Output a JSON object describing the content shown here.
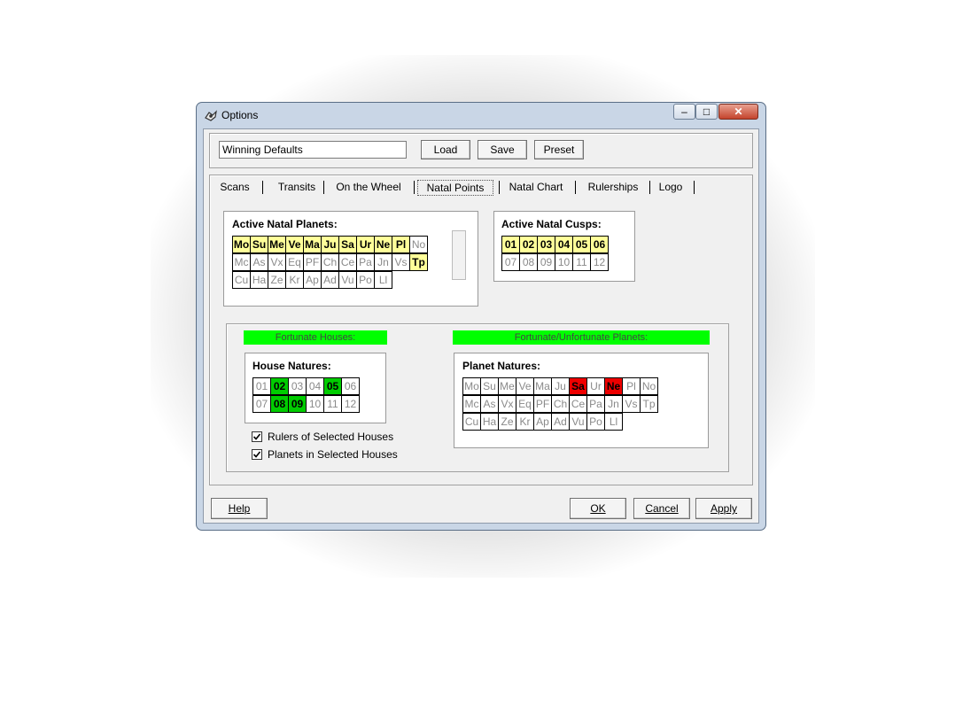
{
  "window": {
    "title": "Options"
  },
  "profile": {
    "name_value": "Winning Defaults",
    "load_label": "Load",
    "save_label": "Save",
    "preset_label": "Preset"
  },
  "tabs": [
    {
      "label": "Scans"
    },
    {
      "label": "Transits"
    },
    {
      "label": "On the Wheel"
    },
    {
      "label": "Natal Points"
    },
    {
      "label": "Natal Chart"
    },
    {
      "label": "Rulerships"
    },
    {
      "label": "Logo"
    }
  ],
  "active_tab": "Natal Points",
  "natal_planets": {
    "title": "Active Natal Planets:",
    "rows": [
      [
        "Mo",
        "Su",
        "Me",
        "Ve",
        "Ma",
        "Ju",
        "Sa",
        "Ur",
        "Ne",
        "Pl",
        "No"
      ],
      [
        "Mc",
        "As",
        "Vx",
        "Eq",
        "PF",
        "Ch",
        "Ce",
        "Pa",
        "Jn",
        "Vs",
        "Tp"
      ],
      [
        "Cu",
        "Ha",
        "Ze",
        "Kr",
        "Ap",
        "Ad",
        "Vu",
        "Po",
        "Ll"
      ]
    ],
    "active": [
      "Mo",
      "Su",
      "Me",
      "Ve",
      "Ma",
      "Ju",
      "Sa",
      "Ur",
      "Ne",
      "Pl",
      "Tp"
    ]
  },
  "natal_cusps": {
    "title": "Active Natal Cusps:",
    "rows": [
      [
        "01",
        "02",
        "03",
        "04",
        "05",
        "06"
      ],
      [
        "07",
        "08",
        "09",
        "10",
        "11",
        "12"
      ]
    ],
    "active": [
      "01",
      "02",
      "03",
      "04",
      "05",
      "06"
    ]
  },
  "fortunate_houses": {
    "bar_label": "Fortunate Houses:",
    "title": "House Natures:",
    "rows": [
      [
        "01",
        "02",
        "03",
        "04",
        "05",
        "06"
      ],
      [
        "07",
        "08",
        "09",
        "10",
        "11",
        "12"
      ]
    ],
    "fortunate": [
      "02",
      "05",
      "08",
      "09"
    ]
  },
  "fortunate_planets": {
    "bar_label": "Fortunate/Unfortunate Planets:",
    "title": "Planet Natures:",
    "rows": [
      [
        "Mo",
        "Su",
        "Me",
        "Ve",
        "Ma",
        "Ju",
        "Sa",
        "Ur",
        "Ne",
        "Pl",
        "No"
      ],
      [
        "Mc",
        "As",
        "Vx",
        "Eq",
        "PF",
        "Ch",
        "Ce",
        "Pa",
        "Jn",
        "Vs",
        "Tp"
      ],
      [
        "Cu",
        "Ha",
        "Ze",
        "Kr",
        "Ap",
        "Ad",
        "Vu",
        "Po",
        "Ll"
      ]
    ],
    "unfortunate": [
      "Sa",
      "Ne"
    ]
  },
  "options": {
    "rulers_label": "Rulers of Selected Houses",
    "rulers_checked": true,
    "planets_label": "Planets in Selected Houses",
    "planets_checked": true
  },
  "footer": {
    "help_label": "Help",
    "ok_label": "OK",
    "cancel_label": "Cancel",
    "apply_label": "Apply"
  },
  "colors": {
    "active": "#ffff99",
    "fortunate": "#00cc00",
    "unfortunate": "#ee0000",
    "bar": "#00ff00"
  }
}
